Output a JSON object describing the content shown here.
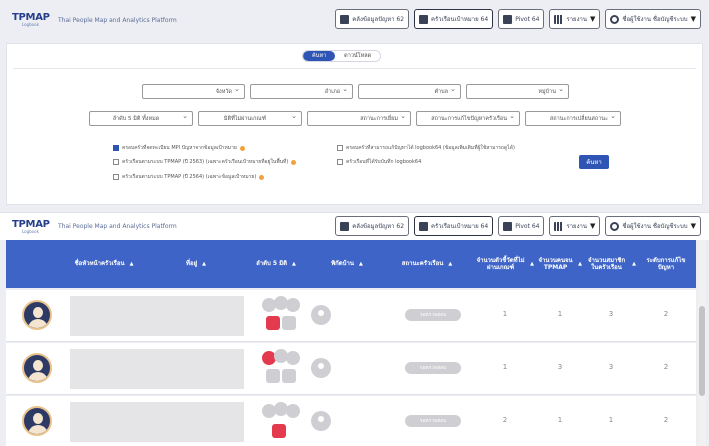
{
  "header": {
    "logo": "TPMAP",
    "logo_sub": "Logbook",
    "tagline": "Thai People Map and Analytics Platform",
    "buttons": [
      {
        "label": "คลังข้อมูลปัญหา 62"
      },
      {
        "label": "ครัวเรือนเป้าหมาย 64"
      },
      {
        "label": "Pivot 64"
      },
      {
        "label": "รายงาน"
      },
      {
        "label": "ชื่อผู้ใช้งาน ชื่อบัญชีระบบ"
      }
    ]
  },
  "header2": {
    "logo": "TPMAP",
    "logo_sub": "Logbook",
    "tagline": "Thai People Map and Analytics Platform",
    "buttons": [
      {
        "label": "คลังข้อมูลปัญหา 62"
      },
      {
        "label": "ครัวเรือนเป้าหมาย 64"
      },
      {
        "label": "Pivot 64"
      },
      {
        "label": "รายงาน"
      },
      {
        "label": "ชื่อผู้ใช้งาน ชื่อบัญชีระบบ"
      }
    ]
  },
  "search": {
    "tabs": [
      "ค้นหา",
      "ดาวน์โหลด"
    ],
    "selects_row1": [
      "จังหวัด",
      "อำเภอ",
      "ตำบล",
      "หมู่บ้าน"
    ],
    "selects_row2": [
      "ลำดับ 5 มิติ ทั้งหมด",
      "มิติที่ไม่ผ่านเกณฑ์",
      "สถานะการเยี่ยม",
      "สถานะการแก้ไขปัญหาครัวเรือน",
      "สถานะการเปลี่ยนสถานะ"
    ],
    "checkboxes": [
      {
        "label": "ครอบครัวที่จดทะเบียน MPI ปัญหาจากข้อมูลเป้าหมาย",
        "checked": true
      },
      {
        "label": "ครัวเรือนตามระบบ TPMAP (ปี 2563) (เฉพาะครัวเรือนเป้าหมายที่อยู่ในพื้นที่)",
        "checked": false
      },
      {
        "label": "ครัวเรือนตามระบบ TPMAP (ปี 2564) (เฉพาะข้อมูลเป้าหมาย)",
        "checked": false
      },
      {
        "label": "ครอบครัวที่สามารถแก้ปัญหาได้ logbook64 (ข้อมูลเพิ่มเติมที่ผู้ใช้สามารถดูได้)",
        "checked": false
      },
      {
        "label": "ครัวเรือนที่ได้รับบันทึก logbook64",
        "checked": false
      }
    ],
    "search_button": "ค้นหา"
  },
  "table": {
    "columns": [
      "ชื่อหัวหน้าครัวเรือน",
      "ที่อยู่",
      "ลำดับ 5 มิติ",
      "พิกัดบ้าน",
      "สถานะครัวเรือน",
      "จำนวนตัวชี้วัดที่ไม่ผ่านเกณฑ์",
      "จำนวนคนจน TPMAP",
      "จำนวนสมาชิกในครัวเรือน",
      "ระดับการแก้ไขปัญหา"
    ],
    "rows": [
      {
        "status": "รอตรวจสอบ",
        "n1": "1",
        "n2": "1",
        "n3": "3",
        "n4": "2"
      },
      {
        "status": "รอตรวจสอบ",
        "n1": "1",
        "n2": "3",
        "n3": "3",
        "n4": "2"
      },
      {
        "status": "รอตรวจสอบ",
        "n1": "2",
        "n2": "1",
        "n3": "1",
        "n4": "2"
      }
    ]
  },
  "colors": {
    "primary": "#3e64c8",
    "alert": "#e33a4e",
    "muted": "#cfcfd3"
  }
}
